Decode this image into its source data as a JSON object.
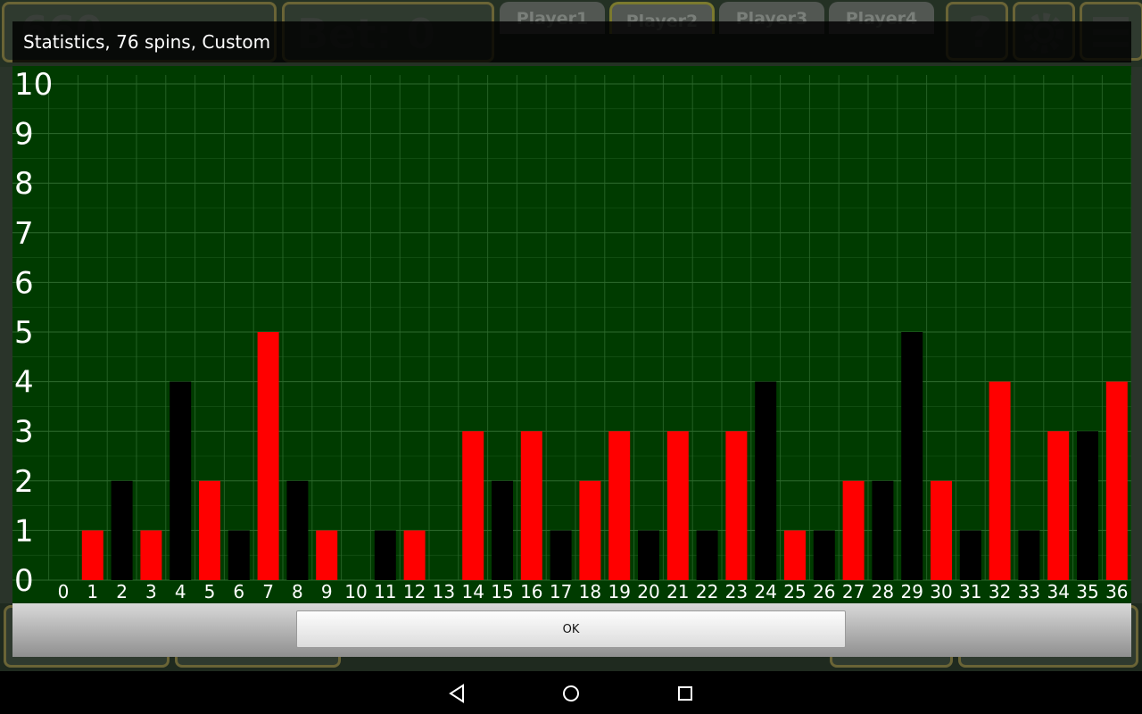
{
  "background": {
    "balance_text": "660",
    "bet_label": "Bet: 0",
    "players": [
      "Player1",
      "Player2",
      "Player3",
      "Player4"
    ],
    "active_player_index": 1,
    "help_symbol": "?"
  },
  "dialog": {
    "title": "Statistics, 76 spins, Custom",
    "ok_label": "OK"
  },
  "colors": {
    "panel_bg": "#003b00",
    "grid": "#2e6a2e",
    "red": "#ff0000",
    "black": "#000000",
    "text": "#ffffff"
  },
  "chart_data": {
    "type": "bar",
    "title": "",
    "xlabel": "",
    "ylabel": "",
    "ylim": [
      0,
      10
    ],
    "yticks": [
      0,
      1,
      2,
      3,
      4,
      5,
      6,
      7,
      8,
      9,
      10
    ],
    "grid": true,
    "categories": [
      "0",
      "1",
      "2",
      "3",
      "4",
      "5",
      "6",
      "7",
      "8",
      "9",
      "10",
      "11",
      "12",
      "13",
      "14",
      "15",
      "16",
      "17",
      "18",
      "19",
      "20",
      "21",
      "22",
      "23",
      "24",
      "25",
      "26",
      "27",
      "28",
      "29",
      "30",
      "31",
      "32",
      "33",
      "34",
      "35",
      "36"
    ],
    "values": [
      0,
      1,
      2,
      1,
      4,
      2,
      1,
      5,
      2,
      1,
      0,
      1,
      1,
      0,
      3,
      2,
      3,
      1,
      2,
      3,
      1,
      3,
      1,
      3,
      4,
      1,
      1,
      2,
      2,
      5,
      2,
      1,
      4,
      1,
      3,
      3,
      4
    ],
    "bar_colors": [
      "green",
      "red",
      "black",
      "red",
      "black",
      "red",
      "black",
      "red",
      "black",
      "red",
      "black",
      "black",
      "red",
      "black",
      "red",
      "black",
      "red",
      "black",
      "red",
      "red",
      "black",
      "red",
      "black",
      "red",
      "black",
      "red",
      "black",
      "red",
      "black",
      "black",
      "red",
      "black",
      "red",
      "black",
      "red",
      "black",
      "red"
    ]
  }
}
